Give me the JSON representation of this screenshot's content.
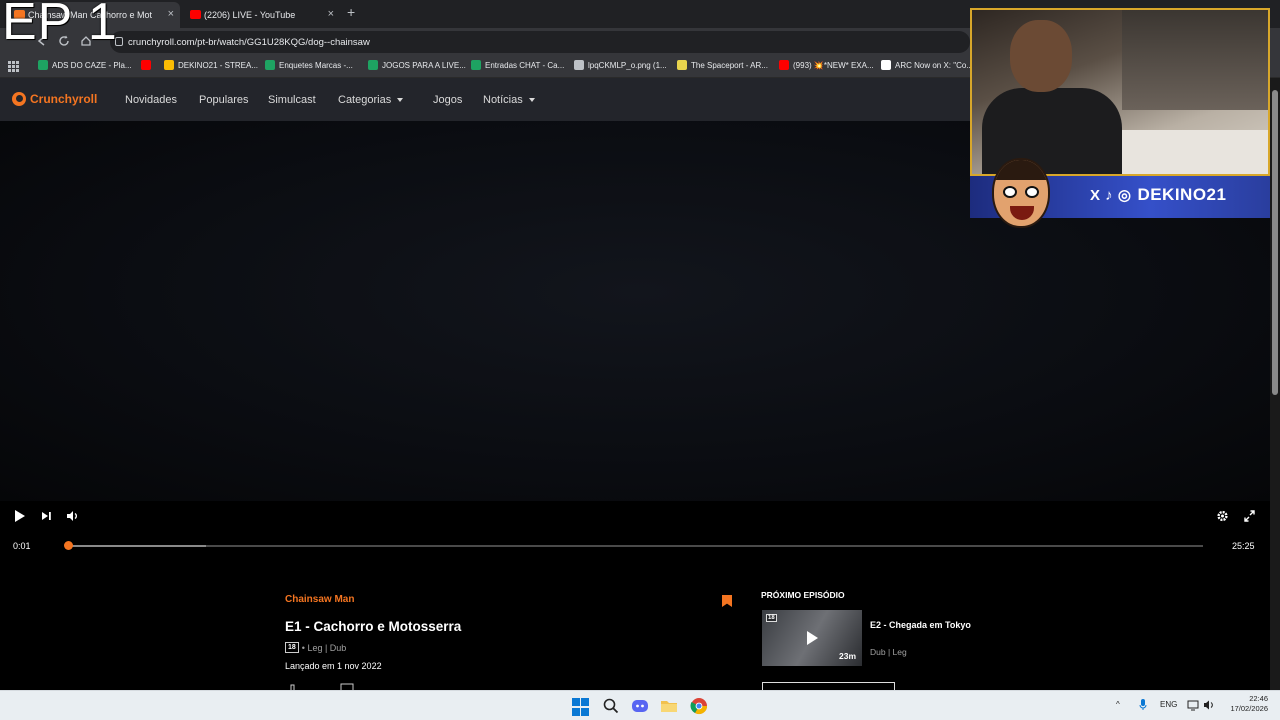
{
  "overlay": {
    "episode_text": "EP 1"
  },
  "browser": {
    "tabs": [
      {
        "title": "Chainsaw Man Cachorro e Mot",
        "active": true,
        "favicon_color": "#f47521"
      },
      {
        "title": "(2206) LIVE - YouTube",
        "active": false,
        "favicon_color": "#ff0000"
      }
    ],
    "close_glyph": "×",
    "new_tab_glyph": "+",
    "url": "crunchyroll.com/pt-br/watch/GG1U28KQG/dog--chainsaw",
    "bookmarks": [
      {
        "label": "ADS DO CAZE - Pla...",
        "icon_color": "#1ea362"
      },
      {
        "label": "",
        "icon_color": "#ff0000"
      },
      {
        "label": "DEKINO21 - STREA...",
        "icon_color": "#fbbc04"
      },
      {
        "label": "Enquetes Marcas -...",
        "icon_color": "#1ea362"
      },
      {
        "label": "JOGOS PARA A LIVE...",
        "icon_color": "#1ea362"
      },
      {
        "label": "Entradas CHAT - Ca...",
        "icon_color": "#1ea362"
      },
      {
        "label": "lpqCKMLP_o.png (1...",
        "icon_color": "#bdc1c6"
      },
      {
        "label": "The Spaceport - AR...",
        "icon_color": "#e8d44d"
      },
      {
        "label": "(993) 💥*NEW* EXA...",
        "icon_color": "#ff0000"
      },
      {
        "label": "ARC Now on X: \"Co...",
        "icon_color": "#ffffff"
      }
    ]
  },
  "site": {
    "brand": "Crunchyroll",
    "brand_color": "#f47521",
    "nav": [
      {
        "label": "Novidades",
        "dropdown": false
      },
      {
        "label": "Populares",
        "dropdown": false
      },
      {
        "label": "Simulcast",
        "dropdown": false
      },
      {
        "label": "Categorias",
        "dropdown": true
      },
      {
        "label": "Jogos",
        "dropdown": false
      },
      {
        "label": "Notícias",
        "dropdown": true
      }
    ]
  },
  "player": {
    "current_time": "0:01",
    "duration": "25:25",
    "played_fraction": 0.0007,
    "buffered_fraction": 0.12
  },
  "episode": {
    "series": "Chainsaw Man",
    "title": "E1 - Cachorro e Motosserra",
    "rating": "18",
    "audio": "• Leg | Dub",
    "released": "Lançado em 1 nov 2022"
  },
  "next": {
    "heading": "PRÓXIMO EPISÓDIO",
    "rating": "18",
    "duration": "23m",
    "title": "E2 - Chegada em Tokyo",
    "audio": "Dub | Leg"
  },
  "stream": {
    "handle": "DEKINO21",
    "social_icons": "X ♪ ◎"
  },
  "taskbar": {
    "language": "ENG",
    "time": "22:46",
    "date": "17/02/2026",
    "chevron": "^"
  }
}
